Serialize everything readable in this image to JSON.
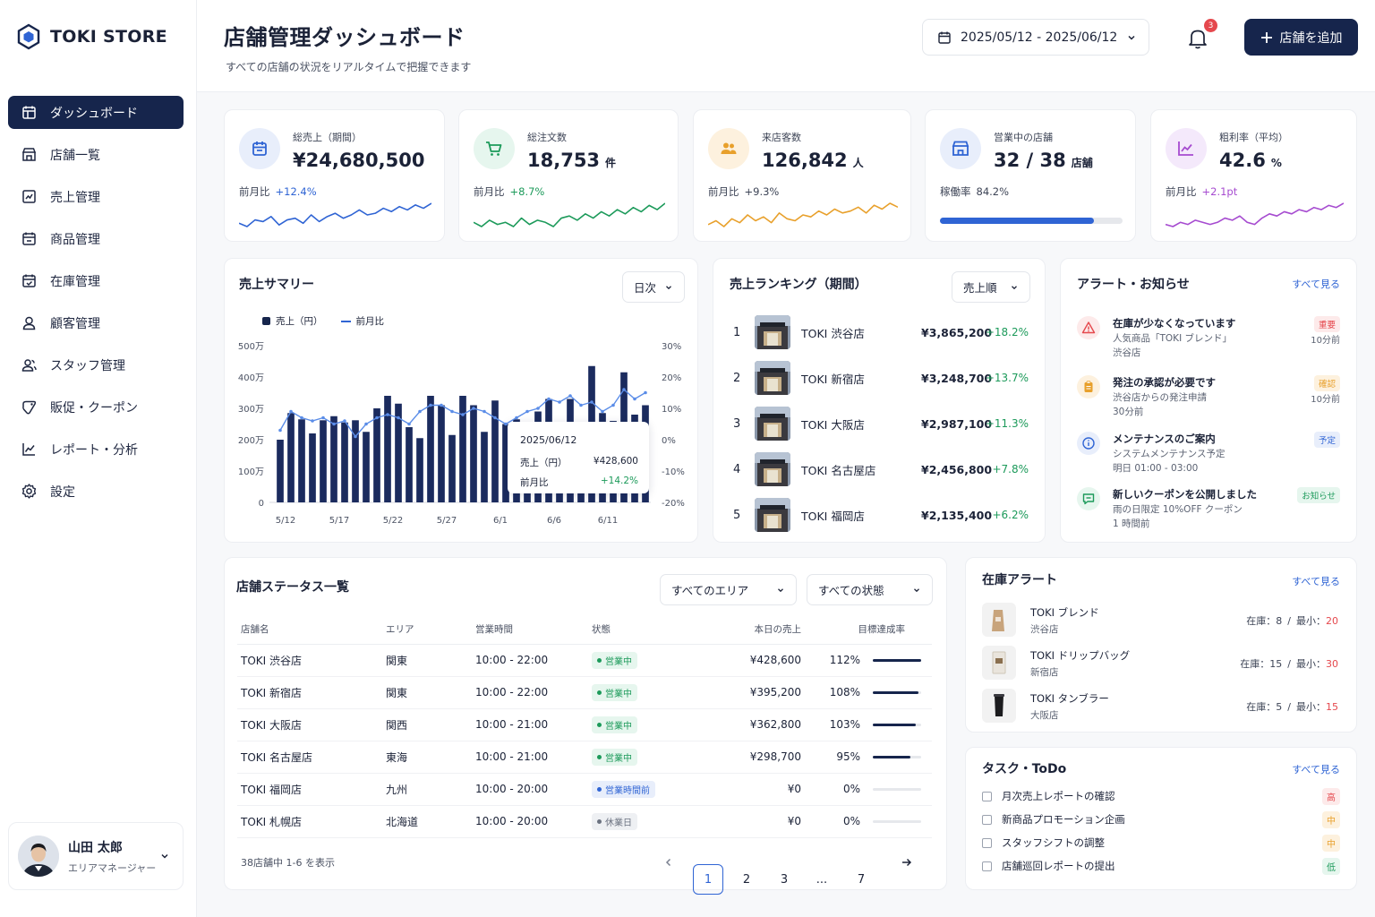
{
  "brand": {
    "name": "TOKI STORE"
  },
  "nav": [
    {
      "label": "ダッシュボード",
      "icon": "dashboard-icon"
    },
    {
      "label": "店舗一覧",
      "icon": "store-icon"
    },
    {
      "label": "売上管理",
      "icon": "sales-chart-icon"
    },
    {
      "label": "商品管理",
      "icon": "product-icon"
    },
    {
      "label": "在庫管理",
      "icon": "inventory-icon"
    },
    {
      "label": "顧客管理",
      "icon": "customer-icon"
    },
    {
      "label": "スタッフ管理",
      "icon": "staff-icon"
    },
    {
      "label": "販促・クーポン",
      "icon": "coupon-icon"
    },
    {
      "label": "レポート・分析",
      "icon": "report-icon"
    },
    {
      "label": "設定",
      "icon": "gear-icon"
    }
  ],
  "user": {
    "name": "山田 太郎",
    "role": "エリアマネージャー"
  },
  "header": {
    "title": "店舗管理ダッシュボード",
    "subtitle": "すべての店舗の状況をリアルタイムで把握できます",
    "date_range": "2025/05/12 - 2025/06/12",
    "notification_count": "3",
    "add_label": "店舗を追加"
  },
  "kpis": [
    {
      "label": "総売上（期間）",
      "value": "¥24,680,500",
      "unit": "",
      "cmp_label": "前月比",
      "cmp_value": "+12.4%",
      "color": "#2f64d4",
      "bg": "#e8eefb",
      "spark": [
        14,
        16,
        12,
        13,
        10,
        15,
        12,
        11,
        14,
        9,
        13,
        10,
        8,
        11,
        9,
        6,
        9,
        8,
        5,
        7,
        4,
        6,
        3,
        5,
        2
      ]
    },
    {
      "label": "総注文数",
      "value": "18,753",
      "unit": "件",
      "cmp_label": "前月比",
      "cmp_value": "+8.7%",
      "color": "#1c9a5a",
      "bg": "#e6f6ee",
      "spark": [
        13,
        15,
        12,
        14,
        13,
        15,
        11,
        14,
        12,
        13,
        15,
        11,
        10,
        12,
        9,
        11,
        8,
        10,
        7,
        9,
        6,
        8,
        5,
        7,
        4
      ]
    },
    {
      "label": "来店客数",
      "value": "126,842",
      "unit": "人",
      "cmp_label": "前月比",
      "cmp_value": "+9.3%",
      "color": "#e8a02b",
      "bg": "#fdf1de",
      "spark": [
        14,
        12,
        15,
        11,
        13,
        9,
        12,
        10,
        13,
        8,
        11,
        12,
        9,
        10,
        7,
        9,
        6,
        8,
        7,
        5,
        8,
        4,
        6,
        3,
        5
      ]
    },
    {
      "label": "営業中の店舗",
      "value": "32 / 38",
      "unit": "店舗",
      "cmp_label": "稼働率",
      "cmp_value": "84.2%",
      "color": "#2f64d4",
      "bg": "#e8eefb",
      "progress": 0.842
    },
    {
      "label": "粗利率（平均）",
      "value": "42.6",
      "unit": "%",
      "cmp_label": "前月比",
      "cmp_value": "+2.1pt",
      "color": "#a64bd0",
      "bg": "#f4e9fb",
      "spark": [
        13,
        14,
        12,
        13,
        11,
        12,
        13,
        12,
        10,
        11,
        9,
        12,
        13,
        10,
        8,
        9,
        7,
        8,
        6,
        7,
        5,
        6,
        4,
        5,
        3
      ]
    }
  ],
  "sales_summary": {
    "title": "売上サマリー",
    "period": "日次",
    "legend_sales": "売上（円）",
    "legend_mom": "前月比",
    "tooltip": {
      "date": "2025/06/12",
      "sales_label": "売上（円）",
      "sales_value": "¥428,600",
      "mom_label": "前月比",
      "mom_value": "+14.2%"
    }
  },
  "chart_data": {
    "type": "bar",
    "title": "売上サマリー",
    "x_ticks": [
      "5/12",
      "5/17",
      "5/22",
      "5/27",
      "6/1",
      "6/6",
      "6/11"
    ],
    "y_ticks_left": [
      "500万",
      "400万",
      "300万",
      "200万",
      "100万",
      "0"
    ],
    "y_ticks_right": [
      "30%",
      "20%",
      "10%",
      "0%",
      "-10%",
      "-20%"
    ],
    "ylim": [
      0,
      500
    ],
    "ylim_right": [
      -20,
      30
    ],
    "series": [
      {
        "name": "売上（円）",
        "type": "bar",
        "values": [
          200,
          285,
          265,
          220,
          262,
          275,
          255,
          262,
          225,
          300,
          340,
          315,
          240,
          205,
          340,
          310,
          215,
          340,
          310,
          225,
          325,
          250,
          265,
          215,
          290,
          330,
          210,
          330,
          235,
          435,
          285,
          260,
          415,
          280,
          310
        ]
      },
      {
        "name": "前月比",
        "type": "line",
        "values": [
          3,
          9,
          7,
          6,
          7,
          5,
          6,
          1,
          5,
          7,
          8,
          7,
          5,
          9,
          11,
          11,
          9,
          8,
          10,
          9,
          7,
          5,
          7,
          9,
          10,
          13,
          12,
          14,
          11,
          12,
          9,
          11,
          16,
          13,
          15
        ]
      }
    ]
  },
  "ranking": {
    "title": "売上ランキング（期間）",
    "sort": "売上順",
    "rows": [
      {
        "rank": "1",
        "name": "TOKI 渋谷店",
        "amount": "¥3,865,200",
        "pct": "+18.2%"
      },
      {
        "rank": "2",
        "name": "TOKI 新宿店",
        "amount": "¥3,248,700",
        "pct": "+13.7%"
      },
      {
        "rank": "3",
        "name": "TOKI 大阪店",
        "amount": "¥2,987,100",
        "pct": "+11.3%"
      },
      {
        "rank": "4",
        "name": "TOKI 名古屋店",
        "amount": "¥2,456,800",
        "pct": "+7.8%"
      },
      {
        "rank": "5",
        "name": "TOKI 福岡店",
        "amount": "¥2,135,400",
        "pct": "+6.2%"
      }
    ]
  },
  "alerts": {
    "title": "アラート・お知らせ",
    "more": "すべて見る",
    "items": [
      {
        "title": "在庫が少なくなっています",
        "d1": "人気商品「TOKI ブレンド」",
        "d2": "渋谷店",
        "tag": "重要",
        "time": "10分前",
        "icon": "warning-icon",
        "color": "#e5484d",
        "bg": "#fdeaea"
      },
      {
        "title": "発注の承認が必要です",
        "d1": "渋谷店からの発注申請",
        "d2": "30分前",
        "tag": "確認",
        "time": "10分前",
        "icon": "clipboard-icon",
        "color": "#e8a02b",
        "bg": "#fdf1de"
      },
      {
        "title": "メンテナンスのご案内",
        "d1": "システムメンテナンス予定",
        "d2": "明日 01:00 - 03:00",
        "tag": "予定",
        "time": "",
        "icon": "info-icon",
        "color": "#2f64d4",
        "bg": "#e8eefb"
      },
      {
        "title": "新しいクーポンを公開しました",
        "d1": "雨の日限定 10%OFF クーポン",
        "d2": "1 時間前",
        "tag": "お知らせ",
        "time": "",
        "icon": "message-icon",
        "color": "#1c9a5a",
        "bg": "#e6f6ee"
      }
    ]
  },
  "store_status": {
    "title": "店舗ステータス一覧",
    "area_filter": "すべてのエリア",
    "status_filter": "すべての状態",
    "columns": [
      "店舗名",
      "エリア",
      "営業時間",
      "状態",
      "本日の売上",
      "目標達成率"
    ],
    "rows": [
      {
        "name": "TOKI 渋谷店",
        "area": "関東",
        "hours": "10:00 - 22:00",
        "status": "営業中",
        "st": "open",
        "sales": "¥428,600",
        "rate": "112%",
        "ratio": 1.0
      },
      {
        "name": "TOKI 新宿店",
        "area": "関東",
        "hours": "10:00 - 22:00",
        "status": "営業中",
        "st": "open",
        "sales": "¥395,200",
        "rate": "108%",
        "ratio": 0.94
      },
      {
        "name": "TOKI 大阪店",
        "area": "関西",
        "hours": "10:00 - 21:00",
        "status": "営業中",
        "st": "open",
        "sales": "¥362,800",
        "rate": "103%",
        "ratio": 0.88
      },
      {
        "name": "TOKI 名古屋店",
        "area": "東海",
        "hours": "10:00 - 21:00",
        "status": "営業中",
        "st": "open",
        "sales": "¥298,700",
        "rate": "95%",
        "ratio": 0.78
      },
      {
        "name": "TOKI 福岡店",
        "area": "九州",
        "hours": "10:00 - 20:00",
        "status": "営業時間前",
        "st": "before",
        "sales": "¥0",
        "rate": "0%",
        "ratio": 0
      },
      {
        "name": "TOKI 札幌店",
        "area": "北海道",
        "hours": "10:00 - 20:00",
        "status": "休業日",
        "st": "closed",
        "sales": "¥0",
        "rate": "0%",
        "ratio": 0
      }
    ],
    "footer": "38店舗中 1-6 を表示",
    "pages": [
      "1",
      "2",
      "3",
      "...",
      "7"
    ]
  },
  "inventory": {
    "title": "在庫アラート",
    "more": "すべて見る",
    "items": [
      {
        "name": "TOKI ブレンド",
        "store": "渋谷店",
        "stock_label": "在庫：8",
        "sep": "/",
        "min_label": "最小：",
        "min": "20"
      },
      {
        "name": "TOKI ドリップバッグ",
        "store": "新宿店",
        "stock_label": "在庫：15",
        "sep": "/",
        "min_label": "最小：",
        "min": "30"
      },
      {
        "name": "TOKI タンブラー",
        "store": "大阪店",
        "stock_label": "在庫：5",
        "sep": "/",
        "min_label": "最小：",
        "min": "15"
      }
    ]
  },
  "tasks": {
    "title": "タスク・ToDo",
    "more": "すべて見る",
    "items": [
      {
        "label": "月次売上レポートの確認",
        "priority": "高",
        "color": "#e5484d",
        "bg": "#fdeaea"
      },
      {
        "label": "新商品プロモーション企画",
        "priority": "中",
        "color": "#e8a02b",
        "bg": "#fdf1de"
      },
      {
        "label": "スタッフシフトの調整",
        "priority": "中",
        "color": "#e8a02b",
        "bg": "#fdf1de"
      },
      {
        "label": "店舗巡回レポートの提出",
        "priority": "低",
        "color": "#1c9a5a",
        "bg": "#e6f6ee"
      }
    ]
  }
}
